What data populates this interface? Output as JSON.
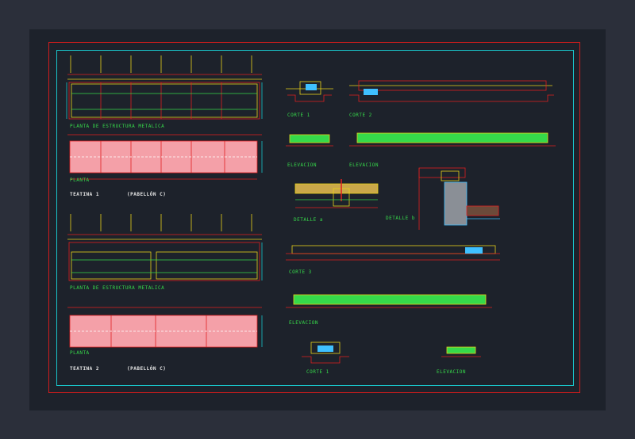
{
  "drawing": {
    "plan_labels": {
      "structure_1": "PLANTA DE ESTRUCTURA METALICA",
      "plan_1": "PLANTA",
      "title_1": "TEATINA 1",
      "pavilion_1": "(PABELLÓN C)",
      "structure_2": "PLANTA DE ESTRUCTURA METALICA",
      "plan_2": "PLANTA",
      "title_2": "TEATINA 2",
      "pavilion_2": "(PABELLÓN C)"
    },
    "section_labels": {
      "corte_1_top": "CORTE 1",
      "corte_2_top": "CORTE 2",
      "elevacion_a": "ELEVACION",
      "elevacion_b": "ELEVACION",
      "detalle_a": "DETALLE a",
      "detalle_b": "DETALLE b",
      "corte_3": "CORTE 3",
      "elevacion_c": "ELEVACION",
      "corte_1_bottom": "CORTE 1",
      "elevacion_d": "ELEVACION"
    },
    "colors": {
      "background": "#1d222b",
      "outer_frame": "#d11c1c",
      "inner_frame": "#19c4c9",
      "line_yellow": "#e8d21a",
      "line_green": "#36d94a",
      "line_red": "#e02020",
      "fill_pink": "#f4a0a8"
    }
  }
}
